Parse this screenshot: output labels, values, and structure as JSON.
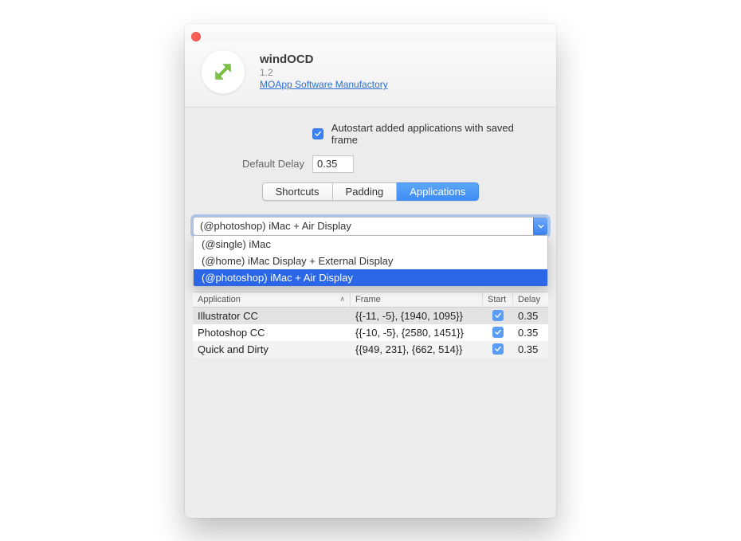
{
  "header": {
    "title": "windOCD",
    "version": "1.2",
    "vendor_link": "MOApp Software Manufactory"
  },
  "prefs": {
    "autostart_label": "Autostart added applications with saved frame",
    "autostart_checked": true,
    "default_delay_label": "Default Delay",
    "default_delay_value": "0.35"
  },
  "tabs": {
    "items": [
      "Shortcuts",
      "Padding",
      "Applications"
    ],
    "active_index": 2
  },
  "combo": {
    "value": "(@photoshop) iMac + Air Display",
    "options": [
      "(@single) iMac",
      "(@home) iMac Display + External Display",
      "(@photoshop) iMac + Air Display"
    ],
    "selected_index": 2
  },
  "table": {
    "columns": {
      "application": "Application",
      "frame": "Frame",
      "start": "Start",
      "delay": "Delay"
    },
    "rows": [
      {
        "application": "Illustrator CC",
        "frame": "{{-11, -5}, {1940, 1095}}",
        "start": true,
        "delay": "0.35"
      },
      {
        "application": "Photoshop CC",
        "frame": "{{-10, -5}, {2580, 1451}}",
        "start": true,
        "delay": "0.35"
      },
      {
        "application": "Quick and Dirty",
        "frame": "{{949, 231}, {662, 514}}",
        "start": true,
        "delay": "0.35"
      }
    ]
  }
}
